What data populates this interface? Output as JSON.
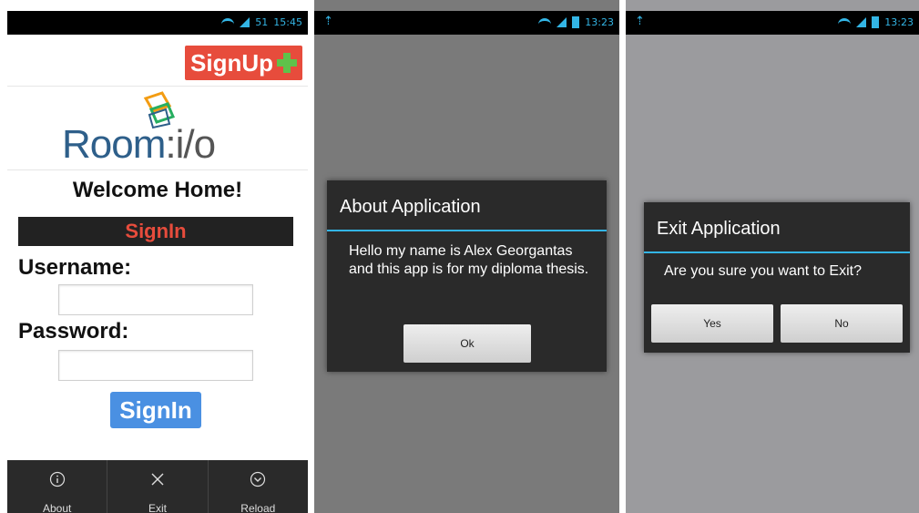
{
  "phone1": {
    "status": {
      "time": "15:45",
      "network": "51"
    },
    "signup_label": "SignUp",
    "logo": {
      "text_main": "Room",
      "text_suffix": ":i/o"
    },
    "welcome": "Welcome Home!",
    "signin_header": "SignIn",
    "username_label": "Username:",
    "password_label": "Password:",
    "username_value": "",
    "password_value": "",
    "signin_button": "SignIn",
    "menu": [
      {
        "label": "About",
        "icon": "info-icon"
      },
      {
        "label": "Exit",
        "icon": "close-icon"
      },
      {
        "label": "Reload",
        "icon": "chevron-down-circle-icon"
      }
    ]
  },
  "phone2": {
    "status": {
      "time": "13:23"
    },
    "dialog": {
      "title": "About Application",
      "message": "Hello my name is Alex Georgantas and this app is for my diploma thesis.",
      "ok": "Ok"
    }
  },
  "phone3": {
    "status": {
      "time": "13:23"
    },
    "dialog": {
      "title": "Exit Application",
      "message": "Are you sure you want to Exit?",
      "yes": "Yes",
      "no": "No"
    }
  },
  "colors": {
    "accent": "#33b5e5",
    "signup": "#e74c3c",
    "signin_button": "#4a90e2",
    "logo_blue": "#2e5f8a"
  }
}
